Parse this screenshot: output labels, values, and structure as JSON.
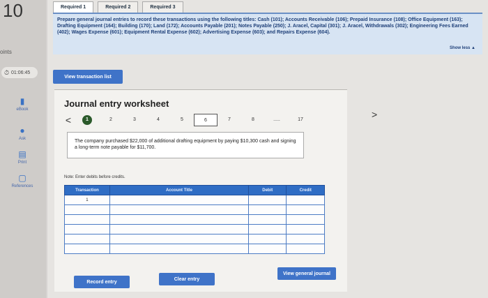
{
  "question_number": "10",
  "points_label": "oints",
  "timer": "01:06:45",
  "rail": {
    "ebook": "eBook",
    "ask": "Ask",
    "print": "Print",
    "references": "References"
  },
  "tabs": [
    "Required 1",
    "Required 2",
    "Required 3"
  ],
  "instructions": "Prepare general journal entries to record these transactions using the following titles: Cash (101); Accounts Receivable (106); Prepaid Insurance (108); Office Equipment (163); Drafting Equipment (164); Building (170); Land (172); Accounts Payable (201); Notes Payable (250); J. Aracel, Capital (301); J. Aracel, Withdrawals (302); Engineering Fees Earned (402); Wages Expense (601); Equipment Rental Expense (602); Advertising Expense (603); and Repairs Expense (604).",
  "show_less": "Show less ▲",
  "view_transaction_list": "View transaction list",
  "worksheet": {
    "title": "Journal entry worksheet",
    "pages": [
      "1",
      "2",
      "3",
      "4",
      "5",
      "6",
      "7",
      "8",
      ".....",
      "17"
    ],
    "prev_arrow": "<",
    "next_arrow": ">",
    "prompt": "The company purchased $22,000 of additional drafting equipment by paying $10,300 cash and signing a long-term note payable for $11,700.",
    "note": "Note: Enter debits before credits.",
    "columns": [
      "Transaction",
      "Account Title",
      "Debit",
      "Credit"
    ],
    "first_transaction": "1",
    "record_entry": "Record entry",
    "clear_entry": "Clear entry",
    "view_general_journal": "View general journal"
  }
}
